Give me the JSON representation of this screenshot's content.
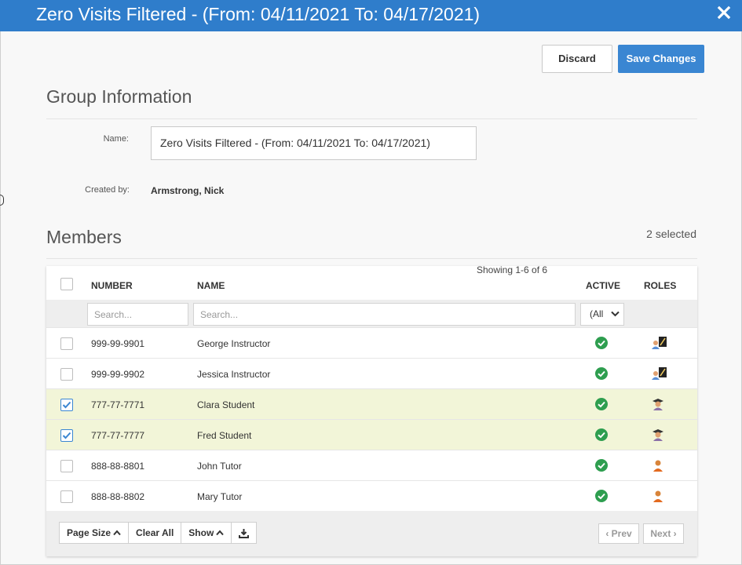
{
  "window": {
    "title": "Zero Visits Filtered - (From: 04/11/2021 To: 04/17/2021)"
  },
  "actions": {
    "discard_label": "Discard",
    "save_label": "Save Changes"
  },
  "group_info": {
    "heading": "Group Information",
    "name_label": "Name:",
    "name_value": "Zero Visits  Filtered - (From: 04/11/2021 To: 04/17/2021)",
    "created_by_label": "Created by:",
    "created_by_value": "Armstrong, Nick"
  },
  "members": {
    "heading": "Members",
    "selected_count": "2 selected",
    "columns": {
      "number": "NUMBER",
      "name": "NAME",
      "active": "ACTIVE",
      "roles": "ROLES"
    },
    "filters": {
      "number_placeholder": "Search...",
      "name_placeholder": "Search...",
      "active_value": "(All"
    },
    "rows": [
      {
        "number": "999-99-9901",
        "name": "George Instructor",
        "selected": false,
        "active": true,
        "role": "instructor"
      },
      {
        "number": "999-99-9902",
        "name": "Jessica Instructor",
        "selected": false,
        "active": true,
        "role": "instructor"
      },
      {
        "number": "777-77-7771",
        "name": "Clara Student",
        "selected": true,
        "active": true,
        "role": "student"
      },
      {
        "number": "777-77-7777",
        "name": "Fred Student",
        "selected": true,
        "active": true,
        "role": "student"
      },
      {
        "number": "888-88-8801",
        "name": "John Tutor",
        "selected": false,
        "active": true,
        "role": "tutor"
      },
      {
        "number": "888-88-8802",
        "name": "Mary Tutor",
        "selected": false,
        "active": true,
        "role": "tutor"
      }
    ],
    "footer": {
      "page_size_label": "Page Size",
      "clear_all_label": "Clear All",
      "show_label": "Show",
      "showing_text": "Showing 1-6 of 6",
      "prev_label": "Prev",
      "next_label": "Next"
    }
  },
  "colors": {
    "header_bg": "#2f7dcb",
    "primary": "#3a86d2",
    "selected_row": "#f2f5d8",
    "active_check": "#2e9e4f"
  }
}
